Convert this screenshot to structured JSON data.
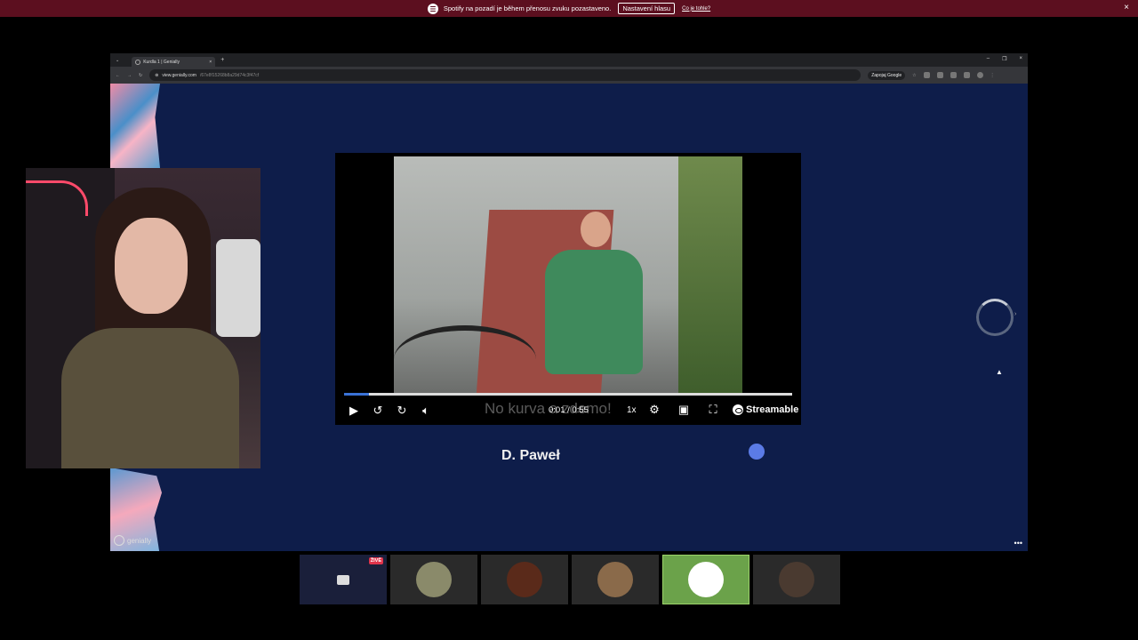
{
  "notification": {
    "message": "Spotify na pozadí je během přenosu zvuku pozastaveno.",
    "button": "Nastavení hlasu",
    "link": "Co je tohle?",
    "close": "×"
  },
  "browser": {
    "tab_title": "Kurdla 1 | Genially",
    "new_tab": "+",
    "window_controls": [
      "–",
      "❐",
      "×"
    ],
    "url_domain": "view.genially.com",
    "url_path": "/67e8f15268b8a29d74c3f47cf",
    "google_button": "Zapojaj Google",
    "menu": "⋮"
  },
  "slide": {
    "caption": "D. Paweł",
    "brand": "genially",
    "menu": "•••"
  },
  "player": {
    "subtitle": "No kurva a zdemo!",
    "time": "0:01 / 0:55",
    "speed": "1x",
    "brand": "Streamable",
    "progress": 0.055
  },
  "participants": [
    {
      "kind": "screen",
      "live_badge": "ŽIVĚ",
      "color": "#1a1f3a"
    },
    {
      "kind": "avatar",
      "color": "#8a8a6a"
    },
    {
      "kind": "avatar",
      "color": "#5a2a1a"
    },
    {
      "kind": "avatar",
      "color": "#8a6a4a"
    },
    {
      "kind": "avatar",
      "color": "#ffffff",
      "active": true
    },
    {
      "kind": "avatar",
      "color": "#4a3a30"
    }
  ]
}
